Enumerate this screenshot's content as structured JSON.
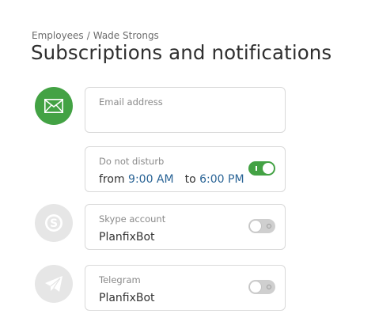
{
  "breadcrumb": {
    "parent": "Employees",
    "separator": "/",
    "current": "Wade Strongs"
  },
  "title": "Subscriptions and notifications",
  "email": {
    "label": "Email address",
    "value": "",
    "icon": "mail-icon",
    "color": "#43a244"
  },
  "dnd": {
    "label": "Do not disturb",
    "from_label": "from",
    "from_time": "9:00 AM",
    "to_label": "to",
    "to_time": "6:00 PM",
    "enabled": true
  },
  "skype": {
    "label": "Skype account",
    "value": "PlanfixBot",
    "icon": "skype-icon",
    "enabled": false
  },
  "telegram": {
    "label": "Telegram",
    "value": "PlanfixBot",
    "icon": "telegram-icon",
    "enabled": false
  },
  "colors": {
    "accent": "#43a244",
    "time": "#2a6496",
    "inactive_icon": "#e6e6e6"
  }
}
